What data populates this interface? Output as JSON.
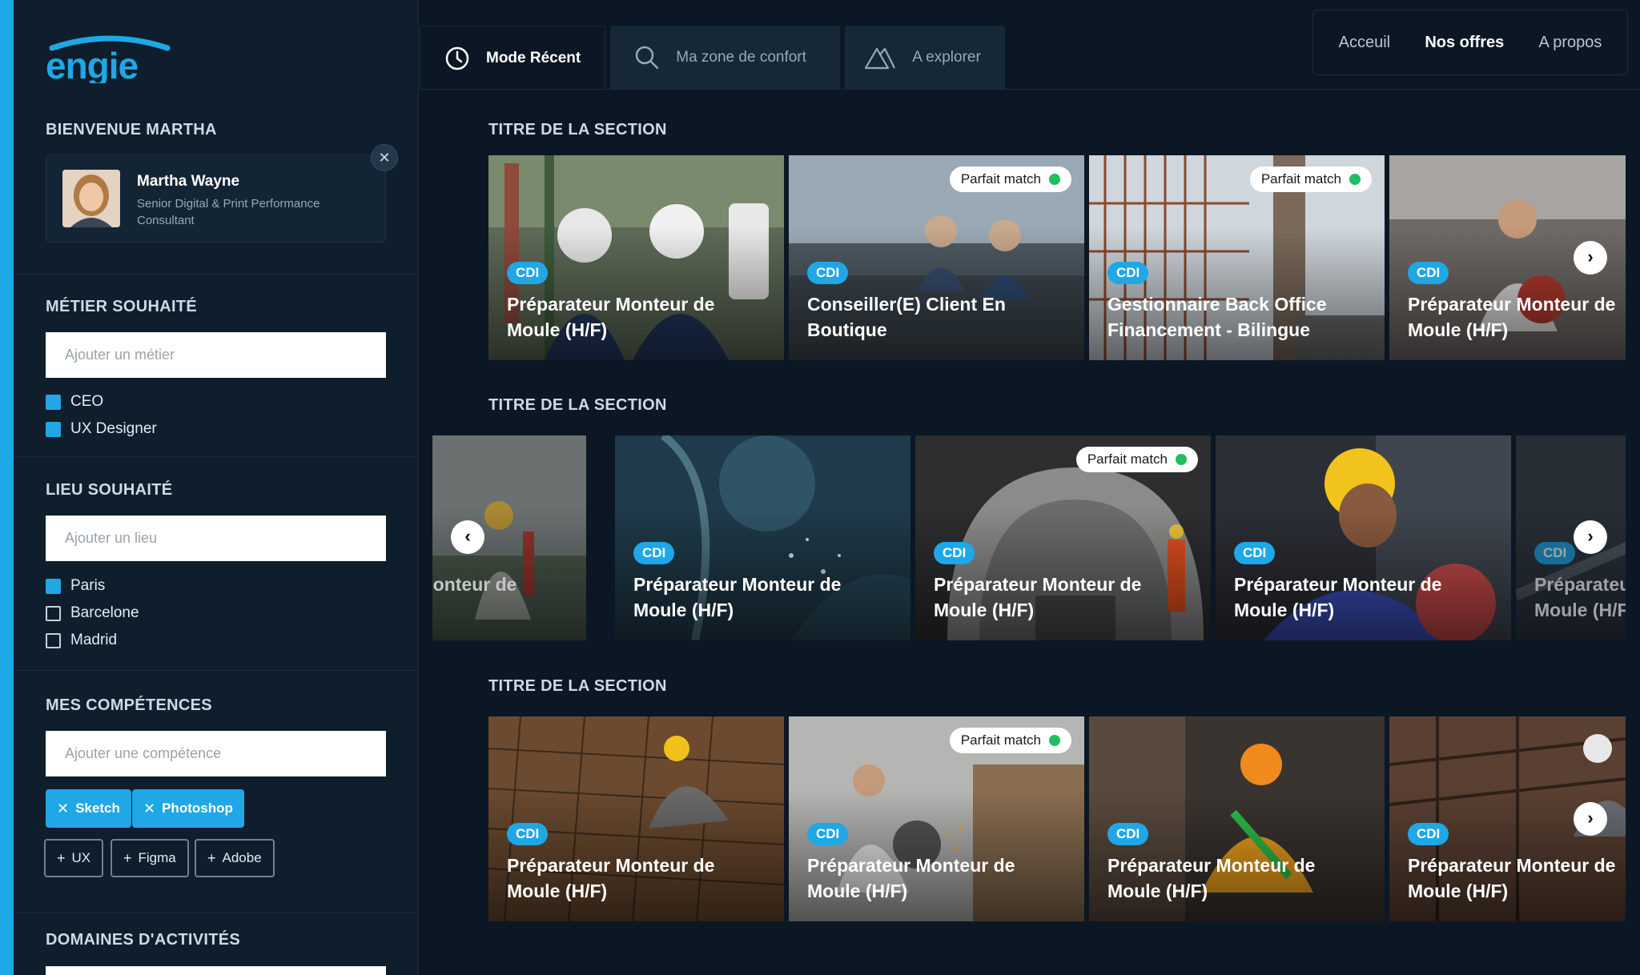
{
  "brand": {
    "logo_text": "engie",
    "accent": "#1fa7e6"
  },
  "sidebar": {
    "welcome": "BIENVENUE MARTHA",
    "profile": {
      "name": "Martha Wayne",
      "role": "Senior Digital & Print Performance Consultant"
    },
    "metier": {
      "title": "MÉTIER SOUHAITÉ",
      "placeholder": "Ajouter un métier",
      "options": [
        {
          "label": "CEO",
          "checked": true
        },
        {
          "label": "UX Designer",
          "checked": true
        }
      ]
    },
    "lieu": {
      "title": "LIEU SOUHAITÉ",
      "placeholder": "Ajouter un lieu",
      "options": [
        {
          "label": "Paris",
          "checked": true
        },
        {
          "label": "Barcelone",
          "checked": false
        },
        {
          "label": "Madrid",
          "checked": false
        }
      ]
    },
    "competences": {
      "title": "MES COMPÉTENCES",
      "placeholder": "Ajouter une compétence",
      "selected": [
        "Sketch",
        "Photoshop"
      ],
      "suggested": [
        "UX",
        "Figma",
        "Adobe"
      ]
    },
    "domaines": {
      "title": "DOMAINES D'ACTIVITÉS"
    }
  },
  "tabs": [
    {
      "label": "Mode Récent",
      "icon": "clock-icon",
      "active": true
    },
    {
      "label": "Ma zone de confort",
      "icon": "search-icon",
      "active": false
    },
    {
      "label": "A explorer",
      "icon": "mountain-icon",
      "active": false
    }
  ],
  "nav": [
    {
      "label": "Acceuil",
      "active": false
    },
    {
      "label": "Nos offres",
      "active": true
    },
    {
      "label": "A propos",
      "active": false
    }
  ],
  "match_label": "Parfait match",
  "sections": [
    {
      "title": "TITRE DE LA SECTION",
      "cards": [
        {
          "badge": "CDI",
          "title": "Préparateur Monteur de Moule (H/F)",
          "match": false
        },
        {
          "badge": "CDI",
          "title": "Conseiller(E) Client En Boutique",
          "match": true
        },
        {
          "badge": "CDI",
          "title": "Gestionnaire Back Office Financement - Bilingue",
          "match": true
        },
        {
          "badge": "CDI",
          "title": "Préparateur Monteur de Moule (H/F)",
          "match": false
        }
      ]
    },
    {
      "title": "TITRE DE LA SECTION",
      "cards": [
        {
          "badge": "",
          "title": "Préparateur Monteur de Moule (H/F)",
          "match": false
        },
        {
          "badge": "CDI",
          "title": "Préparateur Monteur de Moule (H/F)",
          "match": false
        },
        {
          "badge": "CDI",
          "title": "Préparateur Monteur de Moule (H/F)",
          "match": true
        },
        {
          "badge": "CDI",
          "title": "Préparateur Monteur de Moule (H/F)",
          "match": false
        },
        {
          "badge": "CDI",
          "title": "Préparateur Monteur de Moule (H/F)",
          "match": false
        }
      ]
    },
    {
      "title": "TITRE DE LA SECTION",
      "cards": [
        {
          "badge": "CDI",
          "title": "Préparateur Monteur de Moule (H/F)",
          "match": false
        },
        {
          "badge": "CDI",
          "title": "Préparateur Monteur de Moule (H/F)",
          "match": true
        },
        {
          "badge": "CDI",
          "title": "Préparateur Monteur de Moule (H/F)",
          "match": false
        },
        {
          "badge": "CDI",
          "title": "Préparateur Monteur de Moule (H/F)",
          "match": false
        }
      ]
    }
  ]
}
